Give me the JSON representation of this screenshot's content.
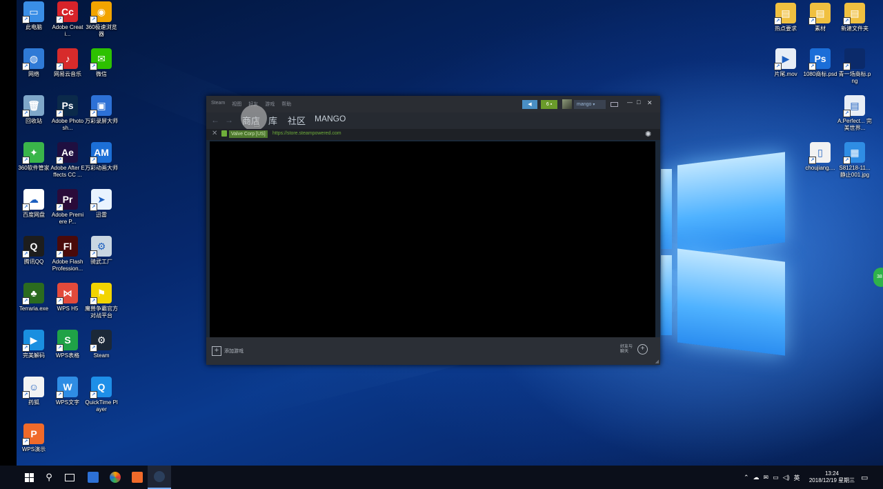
{
  "desktop": {
    "icons_left": [
      {
        "label": "此电脑",
        "color": "#3a8ee6",
        "glyph": "▭"
      },
      {
        "label": "Adobe Creati...",
        "color": "#d8232a",
        "glyph": "Cc"
      },
      {
        "label": "360极速浏览器",
        "color": "#f2a400",
        "glyph": "◉"
      },
      {
        "label": "网络",
        "color": "#2f7ad6",
        "glyph": "◍"
      },
      {
        "label": "网易云音乐",
        "color": "#d72b2b",
        "glyph": "♪"
      },
      {
        "label": "微信",
        "color": "#2dc100",
        "glyph": "✉"
      },
      {
        "label": "回收站",
        "color": "#7fa7c9",
        "glyph": "🗑"
      },
      {
        "label": "Adobe Photosh...",
        "color": "#0b2a4a",
        "glyph": "Ps"
      },
      {
        "label": "万彩录屏大师",
        "color": "#2d71d6",
        "glyph": "▣"
      },
      {
        "label": "360软件管家",
        "color": "#3ab54a",
        "glyph": "✦"
      },
      {
        "label": "Adobe After Effects CC ...",
        "color": "#1f0f40",
        "glyph": "Ae"
      },
      {
        "label": "万彩动画大师",
        "color": "#1c6fd6",
        "glyph": "AM"
      },
      {
        "label": "百度网盘",
        "color": "#ffffff",
        "glyph": "☁"
      },
      {
        "label": "Adobe Premiere P...",
        "color": "#2a0b3a",
        "glyph": "Pr"
      },
      {
        "label": "迅雷",
        "color": "#e9f3ff",
        "glyph": "➤"
      },
      {
        "label": "腾讯QQ",
        "color": "#1d1d1d",
        "glyph": "Q"
      },
      {
        "label": "Adobe Flash Profession...",
        "color": "#4a0a0a",
        "glyph": "Fl"
      },
      {
        "label": "骑武工厂",
        "color": "#c9d6e2",
        "glyph": "⚙"
      },
      {
        "label": "Terraria.exe",
        "color": "#2b6b1f",
        "glyph": "♣"
      },
      {
        "label": "WPS H5",
        "color": "#e24a3b",
        "glyph": "⋈"
      },
      {
        "label": "魔兽争霸官方对战平台",
        "color": "#f2d400",
        "glyph": "⚑"
      },
      {
        "label": "完美解码",
        "color": "#1a8fe0",
        "glyph": "▶"
      },
      {
        "label": "WPS表格",
        "color": "#1fa247",
        "glyph": "S"
      },
      {
        "label": "Steam",
        "color": "#1b2838",
        "glyph": "⚙"
      },
      {
        "label": "药狐",
        "color": "#f3f3f3",
        "glyph": "☺"
      },
      {
        "label": "WPS文字",
        "color": "#2f8de4",
        "glyph": "W"
      },
      {
        "label": "QuickTime Player",
        "color": "#1e8fe8",
        "glyph": "Q"
      },
      {
        "label": "WPS演示",
        "color": "#f06a2a",
        "glyph": "P"
      }
    ],
    "icons_right": [
      {
        "label": "热点要求",
        "color": "#f0c040",
        "glyph": "▤"
      },
      {
        "label": "素材",
        "color": "#f0c040",
        "glyph": "▤"
      },
      {
        "label": "新建文件夹",
        "color": "#f0c040",
        "glyph": "▤"
      },
      {
        "label": "片尾.mov",
        "color": "#e8eef6",
        "glyph": "▶"
      },
      {
        "label": "1080商标.psd",
        "color": "#1b6ed8",
        "glyph": "Ps"
      },
      {
        "label": "青一场商标.png",
        "color": "#0b2a6a",
        "glyph": " "
      },
      {
        "label": "A.Perfect... 完美世界...",
        "color": "#e8eef6",
        "glyph": "▤"
      },
      {
        "label": "choujiang....",
        "color": "#f2f2f2",
        "glyph": "▯"
      },
      {
        "label": "S81218-11... 静止001.jpg",
        "color": "#2f8de4",
        "glyph": "▦"
      }
    ]
  },
  "steam": {
    "menu": [
      "Steam",
      "视图",
      "好友",
      "游戏",
      "帮助"
    ],
    "chat_badge": "6",
    "username": "mango",
    "window_controls": {
      "minimize": "—",
      "maximize": "□",
      "close": "✕"
    },
    "nav_back": "←",
    "nav_forward": "→",
    "tabs": [
      "商店",
      "库",
      "社区",
      "MANGO"
    ],
    "url_bar": {
      "lock_label": "Valve Corp [US]",
      "url": "https://store.steampowered.com"
    },
    "footer": {
      "add_game": "添加游戏",
      "friends_chat": "好友与聊天"
    }
  },
  "taskbar": {
    "time": "13:24",
    "date": "2018/12/19 星期三",
    "ime": "英"
  },
  "edge_badge": "38"
}
